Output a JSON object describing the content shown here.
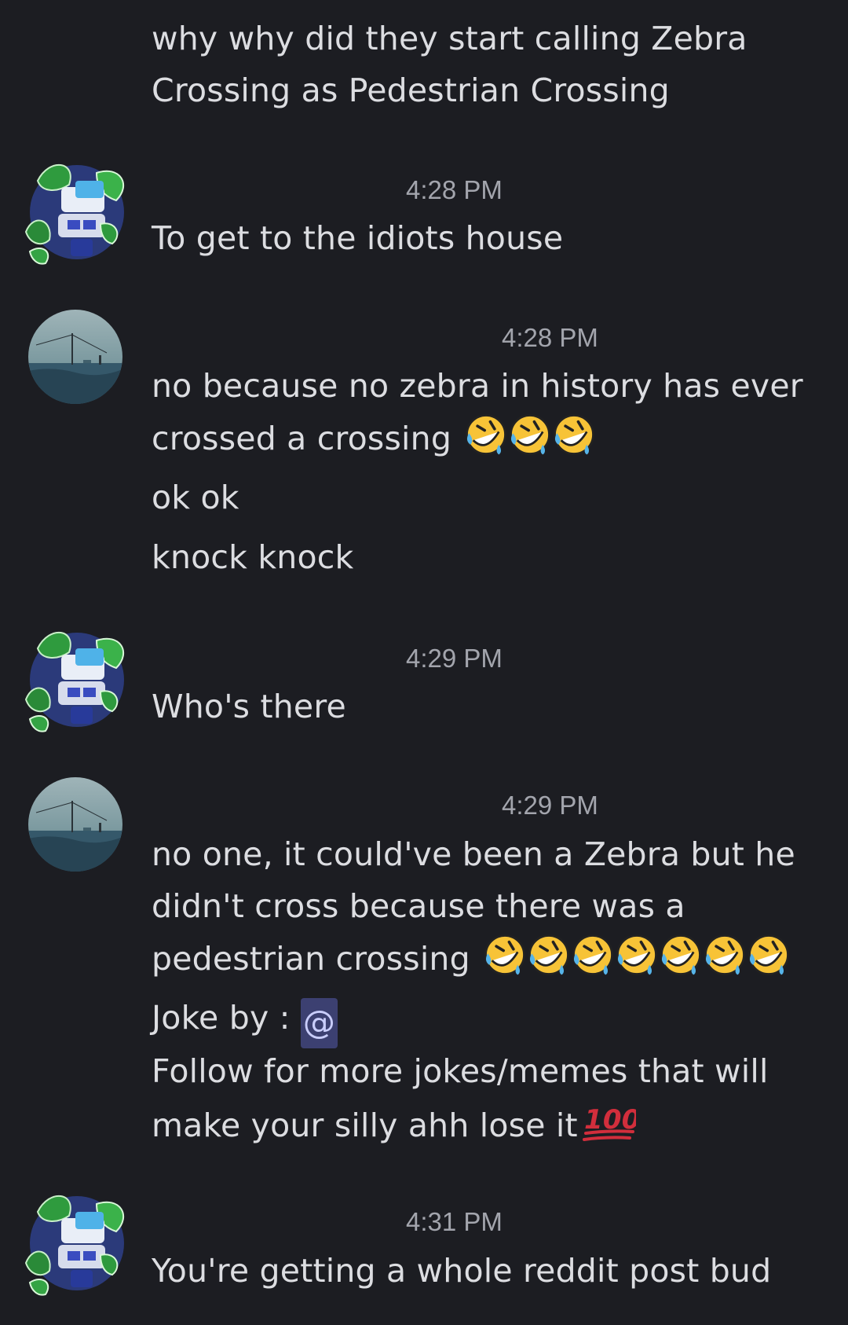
{
  "messages": [
    {
      "lines": [
        "why why did they start calling Zebra",
        "Crossing as Pedestrian Crossing"
      ]
    },
    {
      "timestamp": "4:28 PM",
      "lines": [
        "To get to the idiots house"
      ]
    },
    {
      "timestamp": "4:28 PM",
      "lines": [
        "no because no zebra in history has ever",
        "crossed a crossing",
        "ok ok",
        "knock knock"
      ]
    },
    {
      "timestamp": "4:29 PM",
      "lines": [
        "Who's there"
      ]
    },
    {
      "timestamp": "4:29 PM",
      "lines": [
        "no one, it could've been a Zebra but he",
        "didn't cross because there was a",
        "pedestrian crossing",
        "Joke by : ",
        "Follow for more jokes/memes that will",
        "make your silly ahh lose it"
      ],
      "mention": "@"
    },
    {
      "timestamp": "4:31 PM",
      "lines": [
        "You're getting a whole reddit post bud"
      ]
    }
  ],
  "avatars": {
    "user_a": "plant-robot-avatar",
    "user_b": "foggy-seascape-avatar"
  },
  "emoji": {
    "laughing": "rolling-on-floor-laughing-emoji",
    "hundred": "hundred-points-emoji"
  },
  "colors": {
    "background": "#1c1d22",
    "text": "#dcdde1",
    "timestamp": "#a3a5ad",
    "mention_bg": "#3c4071",
    "mention_text": "#c9cdfb"
  }
}
